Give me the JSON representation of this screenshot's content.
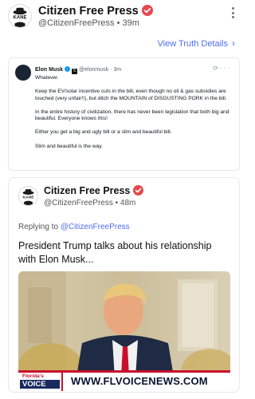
{
  "post": {
    "author_name": "Citizen Free Press",
    "handle": "@CitizenFreePress",
    "separator": "•",
    "time": "39m",
    "view_link": "View Truth Details",
    "avatar_text": "KANE"
  },
  "embed": {
    "name": "Elon Musk",
    "handle": "@elonmusk",
    "time": "3m",
    "x_logo": "𝕏",
    "paragraphs": [
      "Whatever.",
      "Keep the EV/solar incentive cuts in the bill, even though no oil & gas subsidies are touched (very unfair!!), but ditch the MOUNTAIN of DISGUSTING PORK in the bill.",
      "In the entire history of civilization, there has never been legislation that both big and beautiful. Everyone knows this!",
      "Either you get a big and ugly bill or a slim and beautiful bill.",
      "Slim and beautiful is the way."
    ]
  },
  "quoted": {
    "author_name": "Citizen Free Press",
    "handle": "@CitizenFreePress",
    "separator": "•",
    "time": "48m",
    "reply_prefix": "Replying to",
    "reply_to": "@CitizenFreePress",
    "text": "President Trump talks about his relationship with Elon Musk...",
    "media": {
      "logo_line1": "Florida's",
      "logo_line2": "VOICE",
      "url": "WWW.FLVOICENEWS.COM"
    }
  },
  "colors": {
    "accent_link": "#4f6df5",
    "badge_red": "#e5484d",
    "x_verified_blue": "#1d9bf0"
  },
  "icons": [
    "verified-badge-icon",
    "more-options-icon",
    "chevron-right-icon",
    "x-logo-icon",
    "grok-icon",
    "ellipsis-icon"
  ]
}
